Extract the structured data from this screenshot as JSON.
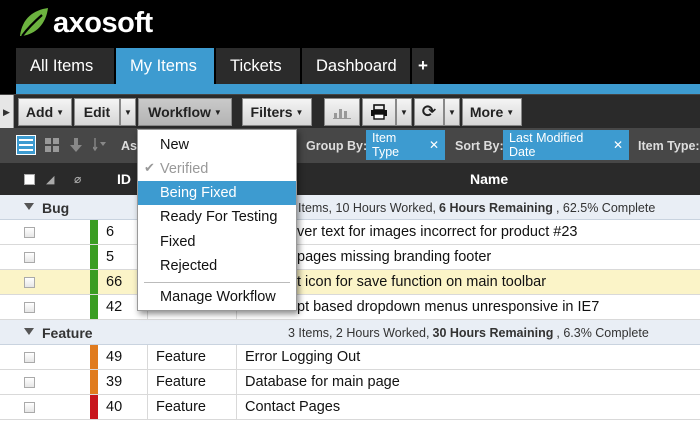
{
  "brand": {
    "name": "axosoft",
    "leaf_color": "#6cb33f"
  },
  "tabs": [
    {
      "label": "All Items",
      "active": false
    },
    {
      "label": "My Items",
      "active": true
    },
    {
      "label": "Tickets",
      "active": false
    },
    {
      "label": "Dashboard",
      "active": false
    },
    {
      "label": "+",
      "active": false
    }
  ],
  "toolbar": {
    "add": "Add",
    "edit": "Edit",
    "workflow": "Workflow",
    "filters": "Filters",
    "more": "More",
    "icons": [
      "chart-icon",
      "print-icon",
      "refresh-icon"
    ]
  },
  "subbar": {
    "group_by_label": "Group By:",
    "group_by_value": "Item Type",
    "sort_by_label": "Sort By:",
    "sort_by_value": "Last Modified Date",
    "item_type_label": "Item Type:",
    "partial_label": "As"
  },
  "columns": {
    "id": "ID",
    "name": "Name"
  },
  "workflow_menu": {
    "items": [
      {
        "label": "New",
        "state": "normal"
      },
      {
        "label": "Verified",
        "state": "disabled-checked"
      },
      {
        "label": "Being Fixed",
        "state": "selected"
      },
      {
        "label": "Ready For Testing",
        "state": "normal"
      },
      {
        "label": "Fixed",
        "state": "normal"
      },
      {
        "label": "Rejected",
        "state": "normal"
      },
      {
        "label": "Manage Workflow",
        "state": "normal"
      }
    ]
  },
  "groups": [
    {
      "title": "Bug",
      "summary_prefix": "Items, 10 Hours Worked,",
      "summary_bold": "6 Hours Remaining",
      "summary_suffix": ", 62.5% Complete",
      "rows": [
        {
          "id": "6",
          "type": "",
          "name": "ver text for images incorrect for product #23",
          "priority_color": "#3a9d23",
          "highlight": false
        },
        {
          "id": "5",
          "type": "",
          "name": "pages missing branding footer",
          "priority_color": "#3a9d23",
          "highlight": false
        },
        {
          "id": "66",
          "type": "",
          "name": "t icon for save function on main toolbar",
          "priority_color": "#3a9d23",
          "highlight": true
        },
        {
          "id": "42",
          "type": "",
          "name": "pt based dropdown menus unresponsive in IE7",
          "priority_color": "#3a9d23",
          "highlight": false
        }
      ]
    },
    {
      "title": "Feature",
      "summary_prefix": "3 Items, 2 Hours Worked,",
      "summary_bold": "30 Hours Remaining",
      "summary_suffix": ", 6.3% Complete",
      "rows": [
        {
          "id": "49",
          "type": "Feature",
          "name": "Error Logging Out",
          "priority_color": "#e07b1e",
          "highlight": false
        },
        {
          "id": "39",
          "type": "Feature",
          "name": "Database for main page",
          "priority_color": "#e07b1e",
          "highlight": false
        },
        {
          "id": "40",
          "type": "Feature",
          "name": "Contact Pages",
          "priority_color": "#c8161d",
          "highlight": false
        }
      ]
    }
  ]
}
